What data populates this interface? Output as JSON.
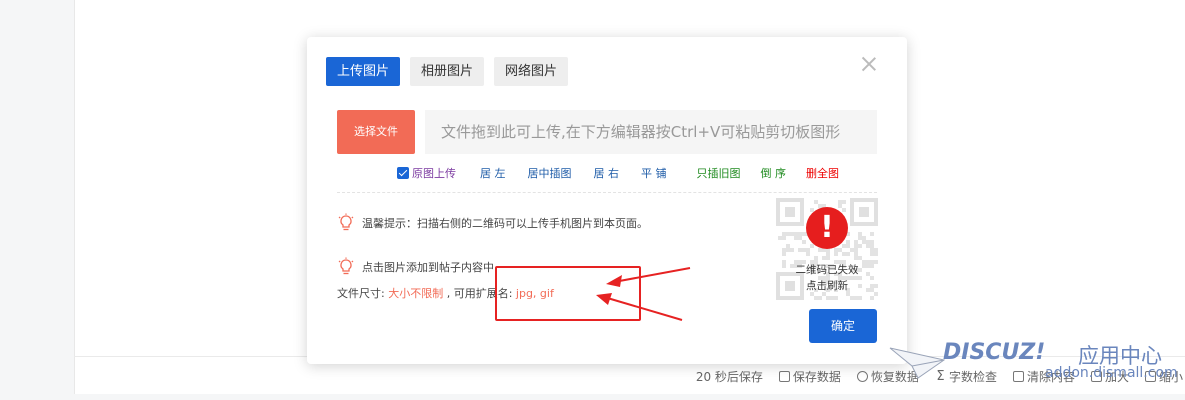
{
  "footer": {
    "autosave_text": "20 秒后保存",
    "save_data": "保存数据",
    "restore_data": "恢复数据",
    "word_check": "字数检查",
    "clear_content": "清除内容",
    "add_size": "加大",
    "shrink": "缩小"
  },
  "dialog": {
    "tabs": [
      "上传图片",
      "相册图片",
      "网络图片"
    ],
    "select_file_label": "选择文件",
    "drop_zone_text": "文件拖到此可上传,在下方编辑器按Ctrl+V可粘贴剪切板图形",
    "options": {
      "original_upload": "原图上传",
      "align_left": "居 左",
      "center_insert": "居中插图",
      "align_right": "居 右",
      "tile": "平 铺",
      "insert_old_only": "只插旧图",
      "reverse_order": "倒 序",
      "delete_all": "删全图",
      "original_upload_checked": true
    },
    "tip_scan": "温馨提示：扫描右侧的二维码可以上传手机图片到本页面。",
    "tip_click": "点击图片添加到帖子内容中",
    "info": {
      "size_label": "文件尺寸: ",
      "size_value": "大小不限制",
      "ext_label": " , 可用扩展名: ",
      "ext_value": "jpg, gif"
    },
    "qr": {
      "expired_text": "二维码已失效",
      "refresh_text": "点击刷新"
    },
    "confirm_label": "确定"
  },
  "watermark": {
    "brand": "DISCUZ!",
    "cn": "应用中心",
    "url": "addon.dismall.com"
  },
  "colors": {
    "primary_blue": "#1a66d6",
    "select_orange": "#f26b56",
    "annotation_red": "#e62222"
  }
}
